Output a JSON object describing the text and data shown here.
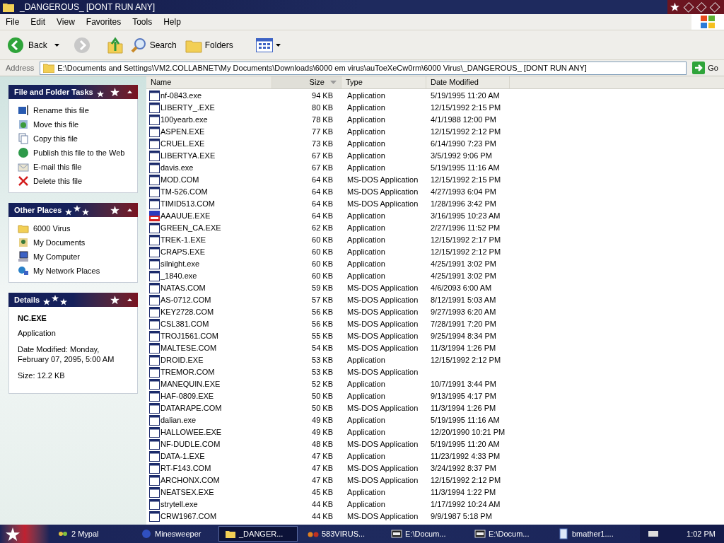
{
  "window": {
    "title": "_DANGEROUS_ [DONT RUN ANY]"
  },
  "menu": [
    "File",
    "Edit",
    "View",
    "Favorites",
    "Tools",
    "Help"
  ],
  "toolbar": [
    {
      "kind": "back",
      "label": "Back"
    },
    {
      "kind": "forward"
    },
    {
      "kind": "up"
    },
    {
      "kind": "search",
      "label": "Search"
    },
    {
      "kind": "folders",
      "label": "Folders"
    },
    {
      "kind": "views"
    }
  ],
  "address": {
    "label": "Address",
    "value": "E:\\Documents and Settings\\VM2.COLLABNET\\My Documents\\Downloads\\6000 em virus\\auToeXeCw0rm\\6000 Virus\\_DANGEROUS_ [DONT RUN ANY]",
    "go": "Go"
  },
  "panels": [
    {
      "title": "File and Folder Tasks",
      "expanded": true,
      "items": [
        {
          "kind": "rename",
          "label": "Rename this file"
        },
        {
          "kind": "move",
          "label": "Move this file"
        },
        {
          "kind": "copy",
          "label": "Copy this file"
        },
        {
          "kind": "publish",
          "label": "Publish this file to the Web"
        },
        {
          "kind": "email",
          "label": "E-mail this file"
        },
        {
          "kind": "delete",
          "label": "Delete this file"
        }
      ]
    },
    {
      "title": "Other Places",
      "expanded": true,
      "items": [
        {
          "kind": "folder",
          "label": "6000 Virus"
        },
        {
          "kind": "documents",
          "label": "My Documents"
        },
        {
          "kind": "computer",
          "label": "My Computer"
        },
        {
          "kind": "network",
          "label": "My Network Places"
        }
      ]
    },
    {
      "title": "Details",
      "expanded": true,
      "details": {
        "name": "NC.EXE",
        "type": "Application",
        "modified": "Date Modified: Monday, February 07, 2095, 5:00 AM",
        "size": "Size: 12.2 KB"
      }
    }
  ],
  "table": {
    "columns": [
      {
        "label": "Name",
        "sorted": false
      },
      {
        "label": "Size",
        "sorted": true
      },
      {
        "label": "Type",
        "sorted": false
      },
      {
        "label": "Date Modified",
        "sorted": false
      }
    ],
    "rows": [
      {
        "kind": "app",
        "name": "nf-0843.exe",
        "size": "94 KB",
        "type": "Application",
        "date": "5/19/1995 11:20 AM"
      },
      {
        "kind": "app",
        "name": "LIBERTY_.EXE",
        "size": "80 KB",
        "type": "Application",
        "date": "12/15/1992 2:15 PM"
      },
      {
        "kind": "app",
        "name": "100yearb.exe",
        "size": "78 KB",
        "type": "Application",
        "date": "4/1/1988 12:00 PM"
      },
      {
        "kind": "app",
        "name": "ASPEN.EXE",
        "size": "77 KB",
        "type": "Application",
        "date": "12/15/1992 2:12 PM"
      },
      {
        "kind": "app",
        "name": "CRUEL.EXE",
        "size": "73 KB",
        "type": "Application",
        "date": "6/14/1990 7:23 PM"
      },
      {
        "kind": "app",
        "name": "LIBERTYA.EXE",
        "size": "67 KB",
        "type": "Application",
        "date": "3/5/1992 9:06 PM"
      },
      {
        "kind": "app",
        "name": "davis.exe",
        "size": "67 KB",
        "type": "Application",
        "date": "5/19/1995 11:16 AM"
      },
      {
        "kind": "app",
        "name": "MOD.COM",
        "size": "64 KB",
        "type": "MS-DOS Application",
        "date": "12/15/1992 2:15 PM"
      },
      {
        "kind": "app",
        "name": "TM-526.COM",
        "size": "64 KB",
        "type": "MS-DOS Application",
        "date": "4/27/1993 6:04 PM"
      },
      {
        "kind": "app",
        "name": "TIMID513.COM",
        "size": "64 KB",
        "type": "MS-DOS Application",
        "date": "1/28/1996 3:42 PM"
      },
      {
        "kind": "custom",
        "name": "AAAUUE.EXE",
        "size": "64 KB",
        "type": "Application",
        "date": "3/16/1995 10:23 AM"
      },
      {
        "kind": "app",
        "name": "GREEN_CA.EXE",
        "size": "62 KB",
        "type": "Application",
        "date": "2/27/1996 11:52 PM"
      },
      {
        "kind": "app",
        "name": "TREK-1.EXE",
        "size": "60 KB",
        "type": "Application",
        "date": "12/15/1992 2:17 PM"
      },
      {
        "kind": "app",
        "name": "CRAPS.EXE",
        "size": "60 KB",
        "type": "Application",
        "date": "12/15/1992 2:12 PM"
      },
      {
        "kind": "app",
        "name": "silnight.exe",
        "size": "60 KB",
        "type": "Application",
        "date": "4/25/1991 3:02 PM"
      },
      {
        "kind": "app",
        "name": "_1840.exe",
        "size": "60 KB",
        "type": "Application",
        "date": "4/25/1991 3:02 PM"
      },
      {
        "kind": "app",
        "name": "NATAS.COM",
        "size": "59 KB",
        "type": "MS-DOS Application",
        "date": "4/6/2093 6:00 AM"
      },
      {
        "kind": "app",
        "name": "AS-0712.COM",
        "size": "57 KB",
        "type": "MS-DOS Application",
        "date": "8/12/1991 5:03 AM"
      },
      {
        "kind": "app",
        "name": "KEY2728.COM",
        "size": "56 KB",
        "type": "MS-DOS Application",
        "date": "9/27/1993 6:20 AM"
      },
      {
        "kind": "app",
        "name": "CSL381.COM",
        "size": "56 KB",
        "type": "MS-DOS Application",
        "date": "7/28/1991 7:20 PM"
      },
      {
        "kind": "app",
        "name": "TROJ1561.COM",
        "size": "55 KB",
        "type": "MS-DOS Application",
        "date": "9/25/1994 8:34 PM"
      },
      {
        "kind": "app",
        "name": "MALTESE.COM",
        "size": "54 KB",
        "type": "MS-DOS Application",
        "date": "11/3/1994 1:26 PM"
      },
      {
        "kind": "app",
        "name": "DROID.EXE",
        "size": "53 KB",
        "type": "Application",
        "date": "12/15/1992 2:12 PM"
      },
      {
        "kind": "app",
        "name": "TREMOR.COM",
        "size": "53 KB",
        "type": "MS-DOS Application"
      },
      {
        "kind": "app",
        "name": "MANEQUIN.EXE",
        "size": "52 KB",
        "type": "Application",
        "date": "10/7/1991 3:44 PM"
      },
      {
        "kind": "app",
        "name": "HAF-0809.EXE",
        "size": "50 KB",
        "type": "Application",
        "date": "9/13/1995 4:17 PM"
      },
      {
        "kind": "app",
        "name": "DATARAPE.COM",
        "size": "50 KB",
        "type": "MS-DOS Application",
        "date": "11/3/1994 1:26 PM"
      },
      {
        "kind": "app",
        "name": "dalian.exe",
        "size": "49 KB",
        "type": "Application",
        "date": "5/19/1995 11:16 AM"
      },
      {
        "kind": "app",
        "name": "HALLOWEE.EXE",
        "size": "49 KB",
        "type": "Application",
        "date": "12/20/1990 10:21 PM"
      },
      {
        "kind": "app",
        "name": "NF-DUDLE.COM",
        "size": "48 KB",
        "type": "MS-DOS Application",
        "date": "5/19/1995 11:20 AM"
      },
      {
        "kind": "app",
        "name": "DATA-1.EXE",
        "size": "47 KB",
        "type": "Application",
        "date": "11/23/1992 4:33 PM"
      },
      {
        "kind": "app",
        "name": "RT-F143.COM",
        "size": "47 KB",
        "type": "MS-DOS Application",
        "date": "3/24/1992 8:37 PM"
      },
      {
        "kind": "app",
        "name": "ARCHONX.COM",
        "size": "47 KB",
        "type": "MS-DOS Application",
        "date": "12/15/1992 2:12 PM"
      },
      {
        "kind": "app",
        "name": "NEATSEX.EXE",
        "size": "45 KB",
        "type": "Application",
        "date": "11/3/1994 1:22 PM"
      },
      {
        "kind": "app",
        "name": "strytell.exe",
        "size": "44 KB",
        "type": "Application",
        "date": "1/17/1992 10:24 AM"
      },
      {
        "kind": "app",
        "name": "CRW1967.COM",
        "size": "44 KB",
        "type": "MS-DOS Application",
        "date": "9/9/1987 5:18 PM"
      }
    ]
  },
  "taskbar": {
    "items": [
      {
        "kind": "browser",
        "label": "2 Mypal",
        "selected": false
      },
      {
        "kind": "game",
        "label": "Minesweeper",
        "selected": false
      },
      {
        "kind": "folder",
        "label": "_DANGER...",
        "selected": true
      },
      {
        "kind": "glasses",
        "label": "583VIRUS...",
        "selected": false
      },
      {
        "kind": "archive",
        "label": "E:\\Docum...",
        "selected": false
      },
      {
        "kind": "archive",
        "label": "E:\\Docum...",
        "selected": false
      },
      {
        "kind": "document",
        "label": "bmather1....",
        "selected": false
      }
    ],
    "clock": "1:02 PM"
  }
}
